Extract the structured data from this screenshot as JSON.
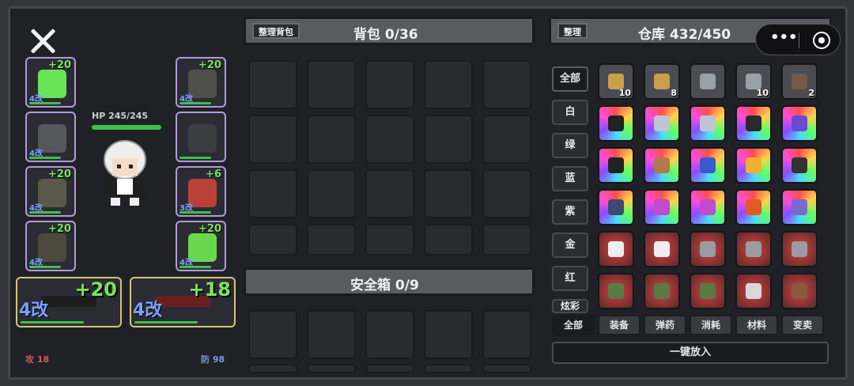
{
  "left": {
    "hp": "HP 245/245",
    "attack": "攻 18",
    "defense": "防 98",
    "slots": [
      {
        "name": "slime",
        "plus": "+20",
        "mod": "4改",
        "color": "#69e35a"
      },
      {
        "name": "armor-vest",
        "plus": "",
        "mod": "4改",
        "color": "#55575d"
      },
      {
        "name": "pants",
        "plus": "+20",
        "mod": "4改",
        "color": "#5a5848"
      },
      {
        "name": "boots",
        "plus": "+20",
        "mod": "4改",
        "color": "#4d4a3d"
      },
      {
        "name": "tactical-vest",
        "plus": "+20",
        "mod": "4改",
        "color": "#4e5047"
      },
      {
        "name": "backpack",
        "plus": "",
        "mod": "",
        "color": "#3c3d40"
      },
      {
        "name": "gloves",
        "plus": "+6",
        "mod": "3改",
        "color": "#b8413a"
      },
      {
        "name": "green-blade",
        "plus": "+20",
        "mod": "4改",
        "color": "#6ad84e"
      }
    ],
    "weapons": [
      {
        "plus": "+20",
        "mod": "4改"
      },
      {
        "plus": "+18",
        "mod": "4改"
      }
    ]
  },
  "bag": {
    "sort_label": "整理背包",
    "title": "背包 0/36"
  },
  "safe": {
    "title": "安全箱 0/9"
  },
  "storage": {
    "sort_label": "整理",
    "title": "仓库 432/450",
    "filters": [
      "全部",
      "白",
      "绿",
      "蓝",
      "紫",
      "金",
      "红",
      "炫彩"
    ],
    "tabs": [
      "全部",
      "装备",
      "弹药",
      "消耗",
      "材料",
      "变卖"
    ],
    "one_click": "一键放入",
    "items": [
      {
        "bg": "grey",
        "icon": "#c9a04a",
        "count": "10"
      },
      {
        "bg": "grey",
        "icon": "#c9a04a",
        "count": "8"
      },
      {
        "bg": "grey",
        "icon": "#9aa0a8",
        "count": ""
      },
      {
        "bg": "grey",
        "icon": "#9aa0a8",
        "count": "10"
      },
      {
        "bg": "grey",
        "icon": "#7a5a44",
        "count": "2"
      },
      {
        "bg": "rainbow",
        "icon": "#222",
        "count": ""
      },
      {
        "bg": "rainbow",
        "icon": "#bfc4d4",
        "count": ""
      },
      {
        "bg": "rainbow",
        "icon": "#bfc4d4",
        "count": ""
      },
      {
        "bg": "rainbow",
        "icon": "#2a2a2a",
        "count": ""
      },
      {
        "bg": "rainbow",
        "icon": "#6a4ad0",
        "count": ""
      },
      {
        "bg": "rainbow",
        "icon": "#222",
        "count": ""
      },
      {
        "bg": "rainbow",
        "icon": "#b07a4a",
        "count": ""
      },
      {
        "bg": "rainbow",
        "icon": "#3a5ad0",
        "count": ""
      },
      {
        "bg": "rainbow",
        "icon": "#f0b030",
        "count": ""
      },
      {
        "bg": "rainbow",
        "icon": "#333",
        "count": ""
      },
      {
        "bg": "rainbow",
        "icon": "#3a4a70",
        "count": ""
      },
      {
        "bg": "rainbow",
        "icon": "#c04ad0",
        "count": ""
      },
      {
        "bg": "rainbow",
        "icon": "#c04ad0",
        "count": ""
      },
      {
        "bg": "rainbow",
        "icon": "#e05a2a",
        "count": ""
      },
      {
        "bg": "rainbow",
        "icon": "#7a6ad0",
        "count": ""
      },
      {
        "bg": "red",
        "icon": "#eeeeee",
        "count": ""
      },
      {
        "bg": "red",
        "icon": "#eeeeee",
        "count": ""
      },
      {
        "bg": "red",
        "icon": "#9a9ca0",
        "count": ""
      },
      {
        "bg": "red",
        "icon": "#9a9ca0",
        "count": ""
      },
      {
        "bg": "red",
        "icon": "#9a9ca0",
        "count": ""
      },
      {
        "bg": "red",
        "icon": "#5a7a44",
        "count": ""
      },
      {
        "bg": "red",
        "icon": "#5a7a44",
        "count": ""
      },
      {
        "bg": "red",
        "icon": "#5a7a44",
        "count": ""
      },
      {
        "bg": "red",
        "icon": "#d8d8d8",
        "count": ""
      },
      {
        "bg": "red",
        "icon": "#8a5a3a",
        "count": ""
      }
    ]
  },
  "colors": {
    "panel": "#202127",
    "border": "#45464c",
    "accent_green": "#7be35f",
    "mod_blue": "#7aa0ff",
    "hp_green": "#3fbf4c",
    "atk_red": "#d45a5a",
    "def_blue": "#7a9ad4"
  }
}
